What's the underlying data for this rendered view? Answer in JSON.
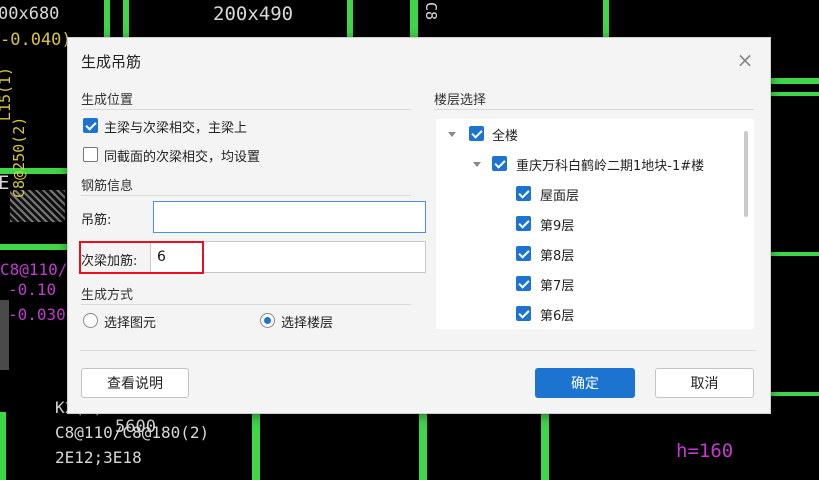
{
  "background": {
    "labels": [
      "00x680",
      "-0.040)",
      "200x490",
      "L15(1)",
      "C8@250(2)",
      "C8@110/",
      "-0.10",
      "-0.030",
      "K2(1)",
      "C8@110/C8@180(2)",
      "2E12;3E18",
      "5600",
      "h=160",
      "E",
      "C8"
    ],
    "colors": {
      "line": "#3fd64a",
      "text": "#d8d8d8",
      "yellow": "#d6c53b",
      "magenta": "#c23ad0",
      "red": "#c8323c"
    }
  },
  "dialog": {
    "title": "生成吊筋",
    "close_icon": "close-icon",
    "position_section": {
      "heading": "生成位置",
      "options": [
        {
          "label": "主梁与次梁相交，主梁上",
          "checked": true
        },
        {
          "label": "同截面的次梁相交，均设置",
          "checked": false
        }
      ]
    },
    "rebar_section": {
      "heading": "钢筋信息",
      "hanger_label": "吊筋:",
      "hanger_value": "",
      "secondary_label": "次梁加筋:",
      "secondary_value": "6"
    },
    "method_section": {
      "heading": "生成方式",
      "options": [
        {
          "label": "选择图元",
          "selected": false
        },
        {
          "label": "选择楼层",
          "selected": true
        }
      ]
    },
    "floor_section": {
      "heading": "楼层选择",
      "root": {
        "label": "全楼",
        "checked": true
      },
      "building": {
        "label": "重庆万科白鹤岭二期1地块-1#楼",
        "checked": true
      },
      "floors": [
        {
          "label": "屋面层",
          "checked": true
        },
        {
          "label": "第9层",
          "checked": true
        },
        {
          "label": "第8层",
          "checked": true
        },
        {
          "label": "第7层",
          "checked": true
        },
        {
          "label": "第6层",
          "checked": true
        }
      ]
    },
    "buttons": {
      "help": "查看说明",
      "ok": "确定",
      "cancel": "取消"
    },
    "accent": "#1c74d0",
    "highlight": "#e8101f"
  }
}
